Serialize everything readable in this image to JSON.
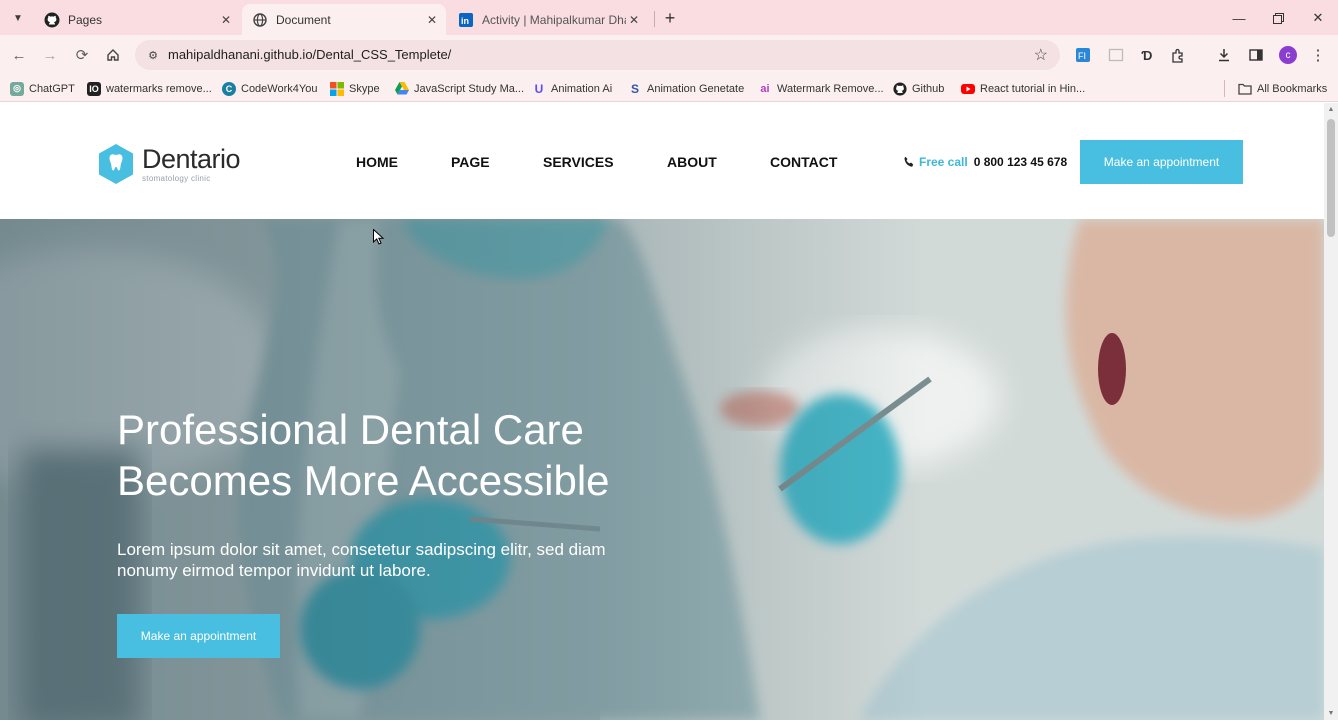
{
  "browser": {
    "tabs": [
      {
        "title": "Pages",
        "active": false
      },
      {
        "title": "Document",
        "active": true
      },
      {
        "title": "Activity | Mahipalkumar Dhanani",
        "active": false
      }
    ],
    "url": "mahipaldhanani.github.io/Dental_CSS_Templete/",
    "profile_initial": "c",
    "bookmarks": [
      {
        "label": "ChatGPT",
        "icon": "chatgpt-icon",
        "color": "#555555"
      },
      {
        "label": "watermarks remove...",
        "icon": "watermark-icon",
        "color": "#222222"
      },
      {
        "label": "CodeWork4You",
        "icon": "codework-icon",
        "color": "#1a7fa0"
      },
      {
        "label": "Skype",
        "icon": "windows-icon",
        "color": "#f25022"
      },
      {
        "label": "JavaScript Study Ma...",
        "icon": "drive-icon",
        "color": "#34a853"
      },
      {
        "label": "Animation Ai",
        "icon": "u-icon",
        "color": "#5b4bff"
      },
      {
        "label": "Animation Genetate",
        "icon": "s-icon",
        "color": "#3355aa"
      },
      {
        "label": "Watermark Remove...",
        "icon": "ai-icon",
        "color": "#b33cc4"
      },
      {
        "label": "Github",
        "icon": "github-icon",
        "color": "#111111"
      },
      {
        "label": "React tutorial in Hin...",
        "icon": "youtube-icon",
        "color": "#ff0000"
      }
    ],
    "all_bookmarks": "All Bookmarks"
  },
  "site": {
    "brand": {
      "name": "Dentario",
      "tagline": "stomatology clinic"
    },
    "nav": [
      "HOME",
      "PAGE",
      "SERVICES",
      "ABOUT",
      "CONTACT"
    ],
    "phone": {
      "label": "Free call",
      "number": "0 800 123 45 678"
    },
    "header_cta": "Make  an  appointment",
    "hero": {
      "title_line1": "Professional Dental Care",
      "title_line2": "Becomes More Accessible",
      "text": "Lorem ipsum dolor sit amet, consetetur sadipscing elitr, sed diam nonumy eirmod tempor invidunt ut labore.",
      "cta": "Make  an  appointment"
    }
  },
  "colors": {
    "accent": "#48bfe0",
    "tab_strip": "#f9dde0",
    "toolbar": "#fbeff0"
  }
}
